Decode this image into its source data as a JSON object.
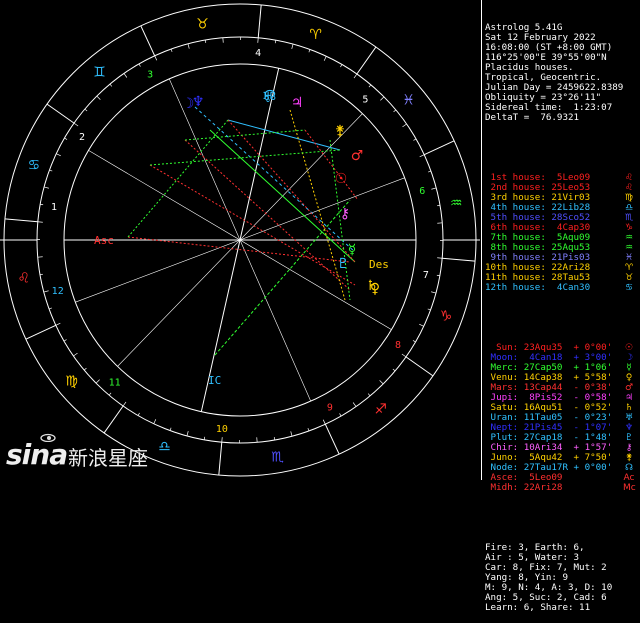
{
  "header": [
    "Astrolog 5.41G",
    "Sat 12 February 2022",
    "16:08:00 (ST +8:00 GMT)",
    "116°25'00\"E 39°55'00\"N",
    "Placidus houses.",
    "Tropical, Geocentric.",
    "Julian Day = 2459622.8389",
    "Obliquity = 23°26'11\"",
    "Sidereal time:  1:23:07",
    "DeltaT =  76.9321"
  ],
  "houses": [
    {
      "text": " 1st house:  5Leo09",
      "color": "#ff2020",
      "glyph": "♌"
    },
    {
      "text": " 2nd house: 25Leo53",
      "color": "#ff2020",
      "glyph": "♌"
    },
    {
      "text": " 3rd house: 21Vir03",
      "color": "#ffd000",
      "glyph": "♍"
    },
    {
      "text": " 4th house: 22Lib28",
      "color": "#30c0ff",
      "glyph": "♎"
    },
    {
      "text": " 5th house: 28Sco52",
      "color": "#5050ff",
      "glyph": "♏"
    },
    {
      "text": " 6th house:  4Cap30",
      "color": "#ff2020",
      "glyph": "♑"
    },
    {
      "text": " 7th house:  5Aqu09",
      "color": "#30ff30",
      "glyph": "♒"
    },
    {
      "text": " 8th house: 25Aqu53",
      "color": "#30ff30",
      "glyph": "♒"
    },
    {
      "text": " 9th house: 21Pis03",
      "color": "#8080ff",
      "glyph": "♓"
    },
    {
      "text": "10th house: 22Ari28",
      "color": "#ffd000",
      "glyph": "♈"
    },
    {
      "text": "11th house: 28Tau53",
      "color": "#ffd000",
      "glyph": "♉"
    },
    {
      "text": "12th house:  4Can30",
      "color": "#30c0ff",
      "glyph": "♋"
    }
  ],
  "planets": [
    {
      "text": "  Sun: 23Aqu35  + 0°00'",
      "color": "#ff2020",
      "glyph": "☉"
    },
    {
      "text": " Moon:  4Can18  + 3°00'",
      "color": "#3030ff",
      "glyph": "☽"
    },
    {
      "text": " Merc: 27Cap50  + 1°06'",
      "color": "#30ff30",
      "glyph": "☿"
    },
    {
      "text": " Venu: 14Cap38  + 5°58'",
      "color": "#ffd000",
      "glyph": "♀"
    },
    {
      "text": " Mars: 13Cap44  - 0°38'",
      "color": "#ff3030",
      "glyph": "♂"
    },
    {
      "text": " Jupi:  8Pis52  - 0°58'",
      "color": "#ff40ff",
      "glyph": "♃"
    },
    {
      "text": " Satu: 16Aqu51  - 0°52'",
      "color": "#ffd000",
      "glyph": "♄"
    },
    {
      "text": " Uran: 11Tau05  - 0°23'",
      "color": "#30c0ff",
      "glyph": "♅"
    },
    {
      "text": " Nept: 21Pis45  - 1°07'",
      "color": "#3030ff",
      "glyph": "♆"
    },
    {
      "text": " Plut: 27Cap18  - 1°48'",
      "color": "#30c0ff",
      "glyph": "♇"
    },
    {
      "text": " Chir: 10Ari34  + 1°57'",
      "color": "#ff60ff",
      "glyph": "⚷"
    },
    {
      "text": " Juno:  5Aqu42  + 7°50'",
      "color": "#ffd000",
      "glyph": "⚵"
    },
    {
      "text": " Node: 27Tau17R + 0°00'",
      "color": "#30c0ff",
      "glyph": "☊"
    },
    {
      "text": " Asce:  5Leo09",
      "color": "#ff3030",
      "glyph": "Ac"
    },
    {
      "text": " Midh: 22Ari28",
      "color": "#ff3030",
      "glyph": "Mc"
    }
  ],
  "summary": [
    "Fire: 3, Earth: 6,",
    "Air : 5, Water: 3",
    "Car: 8, Fix: 7, Mut: 2",
    "Yang: 8, Yin: 9",
    "M: 9, N: 4, A: 3, D: 10",
    "Ang: 5, Suc: 2, Cad: 6",
    "Learn: 6, Share: 11"
  ],
  "watermark": {
    "logo": "sina",
    "text": "新浪星座"
  },
  "signs": [
    "♈",
    "♉",
    "♊",
    "♋",
    "♌",
    "♍",
    "♎",
    "♏",
    "♐",
    "♑",
    "♒",
    "♓"
  ],
  "sign_icons": [
    "aries-icon",
    "taurus-icon",
    "gemini-icon",
    "cancer-icon",
    "leo-icon",
    "virgo-icon",
    "libra-icon",
    "scorpio-icon",
    "sagittarius-icon",
    "capricorn-icon",
    "aquarius-icon",
    "pisces-icon"
  ],
  "sign_colors": [
    "#ffd000",
    "#ffd000",
    "#30c0ff",
    "#30c0ff",
    "#ff3030",
    "#ffd000",
    "#30c0ff",
    "#5050ff",
    "#ff3030",
    "#ff3030",
    "#30ff30",
    "#8080ff"
  ],
  "house_numbers": [
    "1",
    "2",
    "3",
    "4",
    "5",
    "6",
    "7",
    "8",
    "9",
    "10",
    "11",
    "12"
  ],
  "house_number_colors": [
    "#ffffff",
    "#ffffff",
    "#30ff30",
    "#ffffff",
    "#ffffff",
    "#30ff30",
    "#ffffff",
    "#ff3030",
    "#ff3030",
    "#ffd000",
    "#30ff30",
    "#30c0ff"
  ],
  "chart_glyphs": [
    {
      "name": "chiron-glyph",
      "glyph": "⚷",
      "color": "#ff60ff",
      "label": ""
    },
    {
      "name": "sun-glyph",
      "glyph": "☉",
      "color": "#ff3030",
      "label": ""
    },
    {
      "name": "descendant-label",
      "glyph": "",
      "color": "#ffd000",
      "label": "Des"
    },
    {
      "name": "ascendant-label",
      "glyph": "",
      "color": "#ff3030",
      "label": "Asc"
    },
    {
      "name": "midheaven-glyph",
      "glyph": "♅",
      "color": "#30c0ff",
      "label": ""
    },
    {
      "name": "imum-coeli-label",
      "glyph": "",
      "color": "#30c0ff",
      "label": "IC"
    }
  ]
}
